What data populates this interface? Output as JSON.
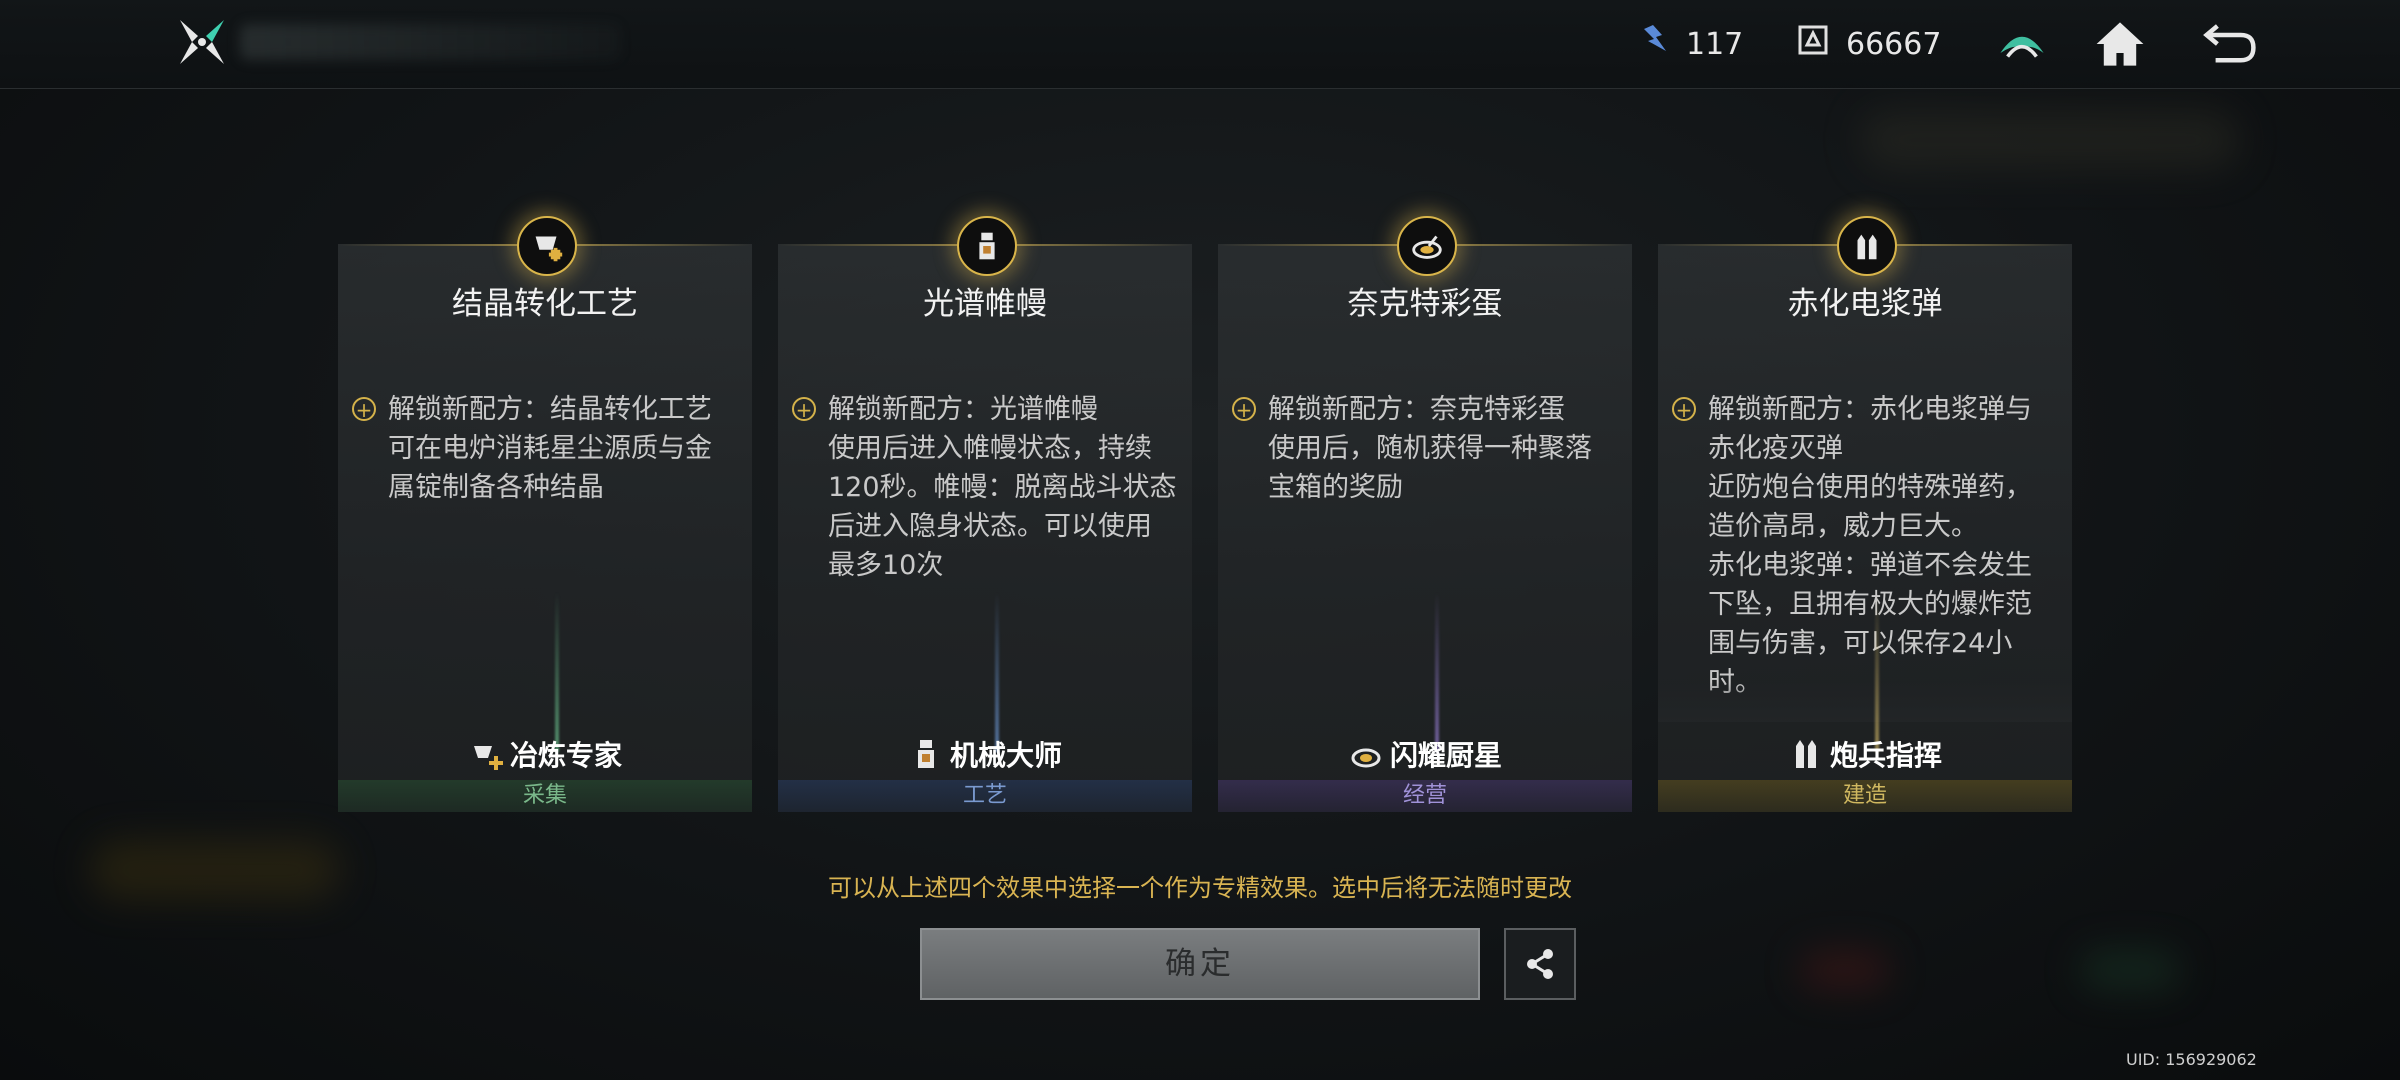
{
  "header": {
    "resources": [
      {
        "icon": "energy-crystal-icon",
        "value": "117"
      },
      {
        "icon": "currency-icon",
        "value": "66667"
      }
    ]
  },
  "cards": [
    {
      "icon": "crystal-conversion-icon",
      "title": "结晶转化工艺",
      "effect_lines": [
        "解锁新配方：结晶转化工艺",
        "可在电炉消耗星尘源质与金",
        "属锭制备各种结晶"
      ],
      "role": "冶炼专家",
      "category": "采集",
      "category_color": "#4a8a5a"
    },
    {
      "icon": "spectrum-tent-icon",
      "title": "光谱帷幔",
      "effect_lines": [
        "解锁新配方：光谱帷幔",
        "使用后进入帷幔状态，持续",
        "120秒。帷幔：脱离战斗状态",
        "后进入隐身状态。可以使用",
        "最多10次"
      ],
      "role": "机械大师",
      "category": "工艺",
      "category_color": "#4a6a9a"
    },
    {
      "icon": "cooking-pan-icon",
      "title": "奈克特彩蛋",
      "effect_lines": [
        "解锁新配方：奈克特彩蛋",
        "使用后，随机获得一种聚落",
        "宝箱的奖励"
      ],
      "role": "闪耀厨星",
      "category": "经营",
      "category_color": "#6a5a9a"
    },
    {
      "icon": "plasma-shell-icon",
      "title": "赤化电浆弹",
      "effect_lines": [
        "解锁新配方：赤化电浆弹与",
        "赤化疫灭弹",
        "近防炮台使用的特殊弹药，",
        "造价高昂，威力巨大。",
        "赤化电浆弹：弹道不会发生",
        "下坠，且拥有极大的爆炸范",
        "围与伤害，可以保存24小",
        "时。"
      ],
      "role": "炮兵指挥",
      "category": "建造",
      "category_color": "#9a8a3a"
    }
  ],
  "hint": "可以从上述四个效果中选择一个作为专精效果。选中后将无法随时更改",
  "confirm_label": "确定",
  "uid": "UID: 156929062"
}
